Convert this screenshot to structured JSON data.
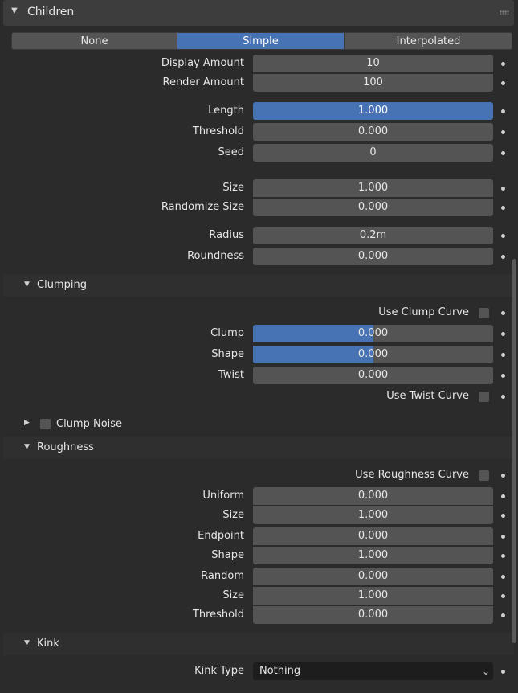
{
  "panel": {
    "title": "Children"
  },
  "mode_tabs": [
    {
      "label": "None"
    },
    {
      "label": "Simple"
    },
    {
      "label": "Interpolated"
    }
  ],
  "children": {
    "display_amount": {
      "label": "Display Amount",
      "value": "10"
    },
    "render_amount": {
      "label": "Render Amount",
      "value": "100"
    },
    "length": {
      "label": "Length",
      "value": "1.000",
      "fill": 1.0
    },
    "threshold": {
      "label": "Threshold",
      "value": "0.000"
    },
    "seed": {
      "label": "Seed",
      "value": "0"
    },
    "size": {
      "label": "Size",
      "value": "1.000"
    },
    "randomize_size": {
      "label": "Randomize Size",
      "value": "0.000"
    },
    "radius": {
      "label": "Radius",
      "value": "0.2m"
    },
    "roundness": {
      "label": "Roundness",
      "value": "0.000"
    }
  },
  "clumping": {
    "title": "Clumping",
    "use_clump_curve": "Use Clump Curve",
    "clump": {
      "label": "Clump",
      "value": "0.000",
      "fill": 0.5
    },
    "shape": {
      "label": "Shape",
      "value": "0.000",
      "fill": 0.5
    },
    "twist": {
      "label": "Twist",
      "value": "0.000"
    },
    "use_twist_curve": "Use Twist Curve",
    "clump_noise": "Clump Noise"
  },
  "roughness": {
    "title": "Roughness",
    "use_roughness_curve": "Use Roughness Curve",
    "uniform": {
      "label": "Uniform",
      "value": "0.000"
    },
    "uniform_size": {
      "label": "Size",
      "value": "1.000"
    },
    "endpoint": {
      "label": "Endpoint",
      "value": "0.000"
    },
    "endpoint_shape": {
      "label": "Shape",
      "value": "1.000"
    },
    "random": {
      "label": "Random",
      "value": "0.000"
    },
    "random_size": {
      "label": "Size",
      "value": "1.000"
    },
    "random_threshold": {
      "label": "Threshold",
      "value": "0.000"
    }
  },
  "kink": {
    "title": "Kink",
    "kink_type_label": "Kink Type",
    "kink_type_value": "Nothing"
  },
  "icons": {
    "expanded": "triangle-down-icon",
    "collapsed": "triangle-right-icon",
    "grip": "drag-grip-icon",
    "keyframe": "keyframe-dot-icon",
    "dropdown": "chevron-down-icon"
  },
  "colors": {
    "accent": "#4772b3",
    "field": "#545454",
    "background": "#2b2b2b",
    "header": "#3d3d3d"
  }
}
